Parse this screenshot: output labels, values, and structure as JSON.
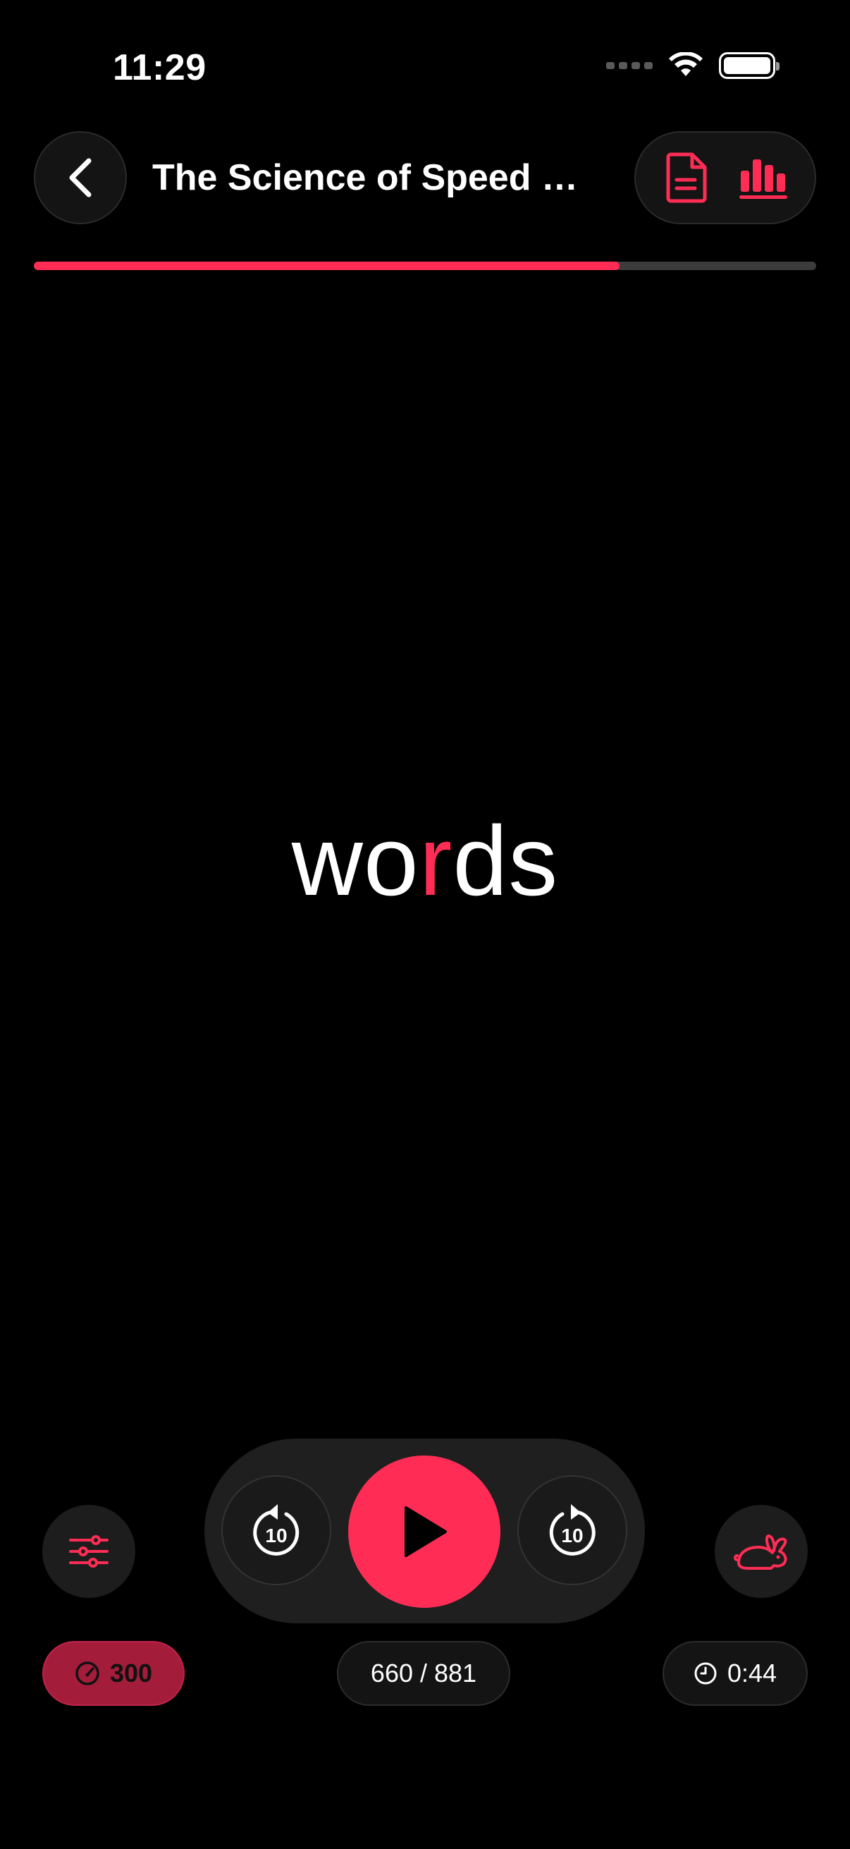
{
  "status": {
    "time": "11:29"
  },
  "header": {
    "title": "The Science of Speed Re...",
    "back_icon": "chevron-left-icon",
    "actions": [
      {
        "icon": "document-icon"
      },
      {
        "icon": "bar-chart-icon"
      }
    ]
  },
  "progress": {
    "fraction": 0.749
  },
  "reader": {
    "word_before": "wo",
    "word_focus": "r",
    "word_after": "ds"
  },
  "controls": {
    "skip_back_label": "10",
    "skip_forward_label": "10",
    "play_icon": "play-icon",
    "settings_icon": "sliders-icon",
    "speed_mode_icon": "rabbit-icon"
  },
  "footer": {
    "wpm": "300",
    "word_count": "660 / 881",
    "time_remaining": "0:44"
  },
  "colors": {
    "accent": "#ff2d55",
    "background": "#000000",
    "surface": "#1f1f1f",
    "wpm_pill": "#a31d3b"
  }
}
